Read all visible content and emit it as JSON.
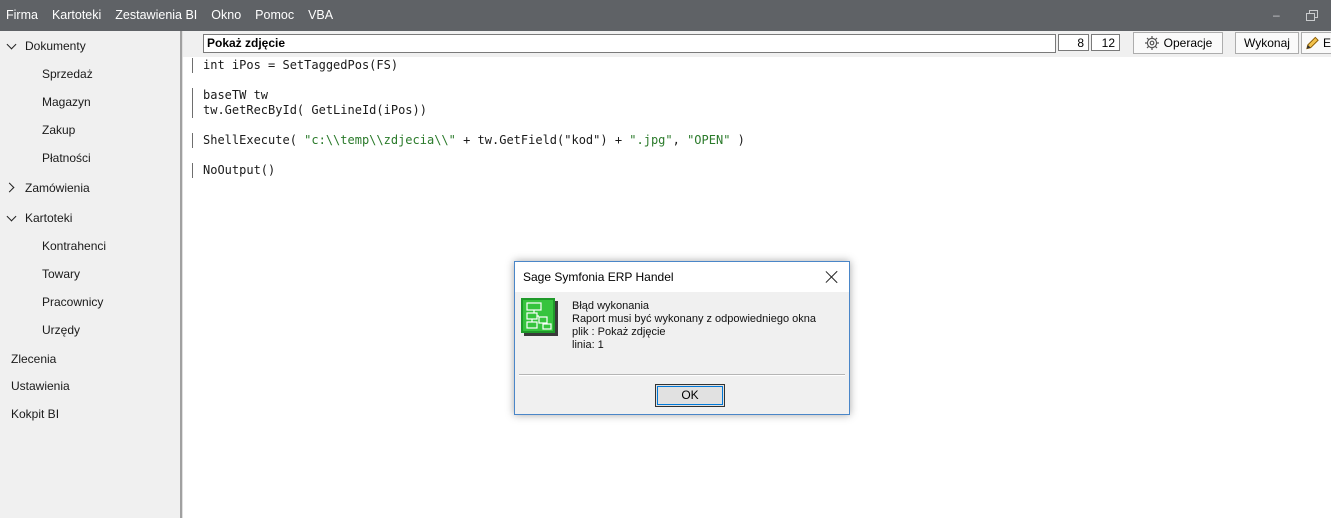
{
  "menu": [
    "Firma",
    "Kartoteki",
    "Zestawienia BI",
    "Okno",
    "Pomoc",
    "VBA"
  ],
  "window_controls": {
    "minimize_icon": "minimize-icon",
    "restore_icon": "restore-icon"
  },
  "sidebar": {
    "groups": [
      {
        "label": "Dokumenty",
        "expanded": true,
        "items": [
          "Sprzedaż",
          "Magazyn",
          "Zakup",
          "Płatności"
        ]
      },
      {
        "label": "Zamówienia",
        "expanded": false,
        "items": []
      },
      {
        "label": "Kartoteki",
        "expanded": true,
        "items": [
          "Kontrahenci",
          "Towary",
          "Pracownicy",
          "Urzędy"
        ]
      }
    ],
    "links": [
      "Zlecenia",
      "Ustawienia",
      "Kokpit BI"
    ]
  },
  "toolbar": {
    "report_name": "Pokaż zdjęcie",
    "line": "8",
    "column": "12",
    "operations_label": "Operacje",
    "execute_label": "Wykonaj",
    "edit_label_partial": "E"
  },
  "code": {
    "line1": "int iPos = SetTaggedPos(FS)",
    "line3": "baseTW tw",
    "line4": "tw.GetRecById( GetLineId(iPos))",
    "line6_a": "ShellExecute( ",
    "line6_s1": "\"c:\\\\temp\\\\zdjecia\\\\\"",
    "line6_b": " + tw.GetField(\"kod\") + ",
    "line6_s2": "\".jpg\"",
    "line6_c": ", ",
    "line6_s3": "\"OPEN\"",
    "line6_d": " )",
    "line8": "NoOutput()"
  },
  "dialog": {
    "title": "Sage Symfonia ERP Handel",
    "line1": "Błąd wykonania",
    "line2": "Raport musi być wykonany z odpowiedniego okna",
    "line3": "plik : Pokaż zdjęcie",
    "line4": "linia: 1",
    "ok_label": "OK"
  }
}
